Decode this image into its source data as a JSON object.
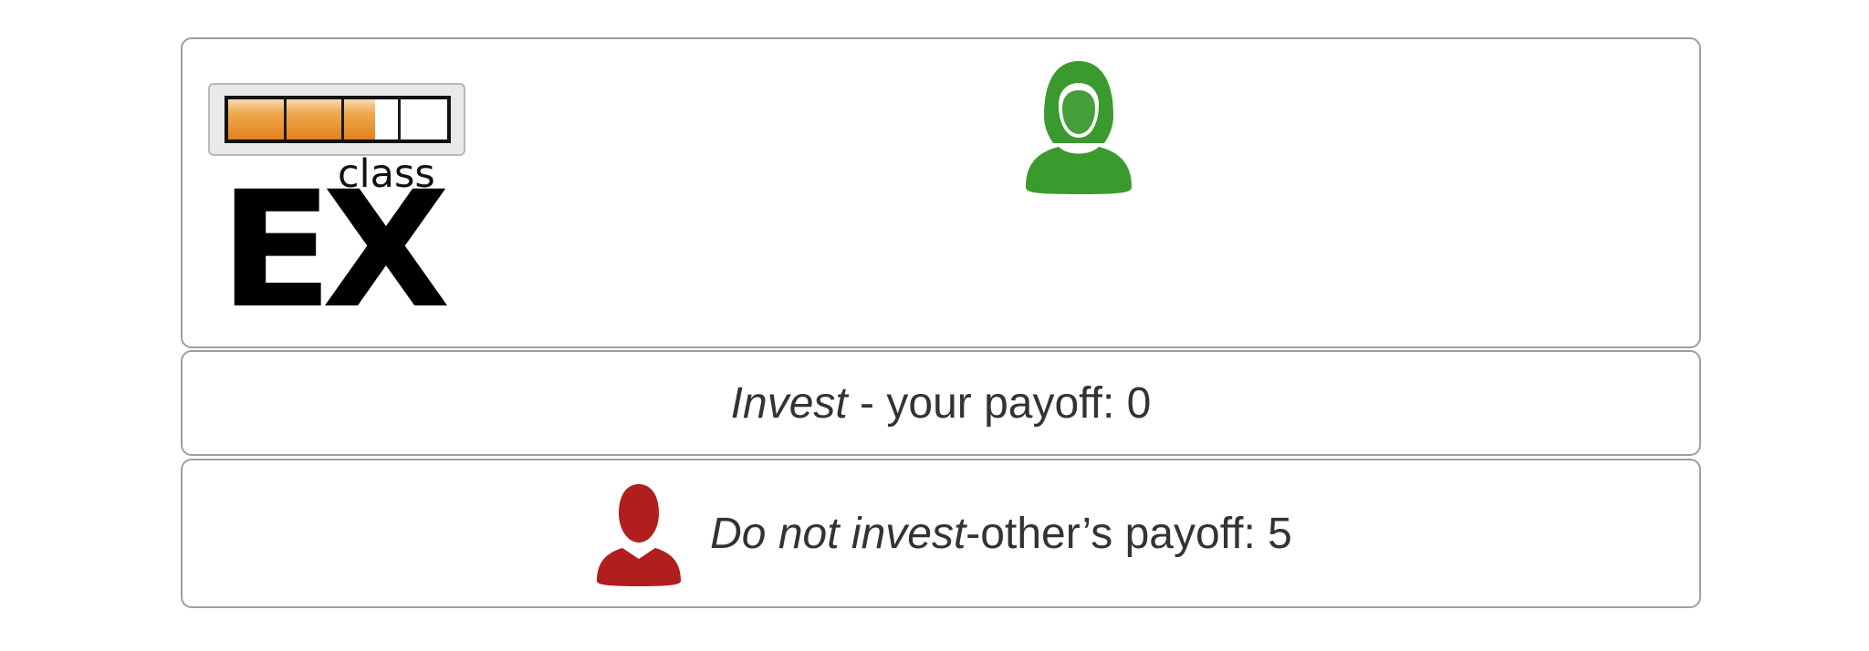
{
  "logo": {
    "superscript": "class",
    "main": "EX",
    "progress_fraction": 0.67,
    "colors": {
      "fill": "#e0821e",
      "text": "#000000"
    }
  },
  "player": {
    "icon": "female-person-icon",
    "color": "#3a9a2e"
  },
  "options": [
    {
      "action": "Invest",
      "separator": " - ",
      "description": "your payoff: 0"
    },
    {
      "icon": "male-person-icon",
      "icon_color": "#b11e1e",
      "action": "Do not invest",
      "separator": " - ",
      "description": "other’s payoff: 5"
    }
  ]
}
